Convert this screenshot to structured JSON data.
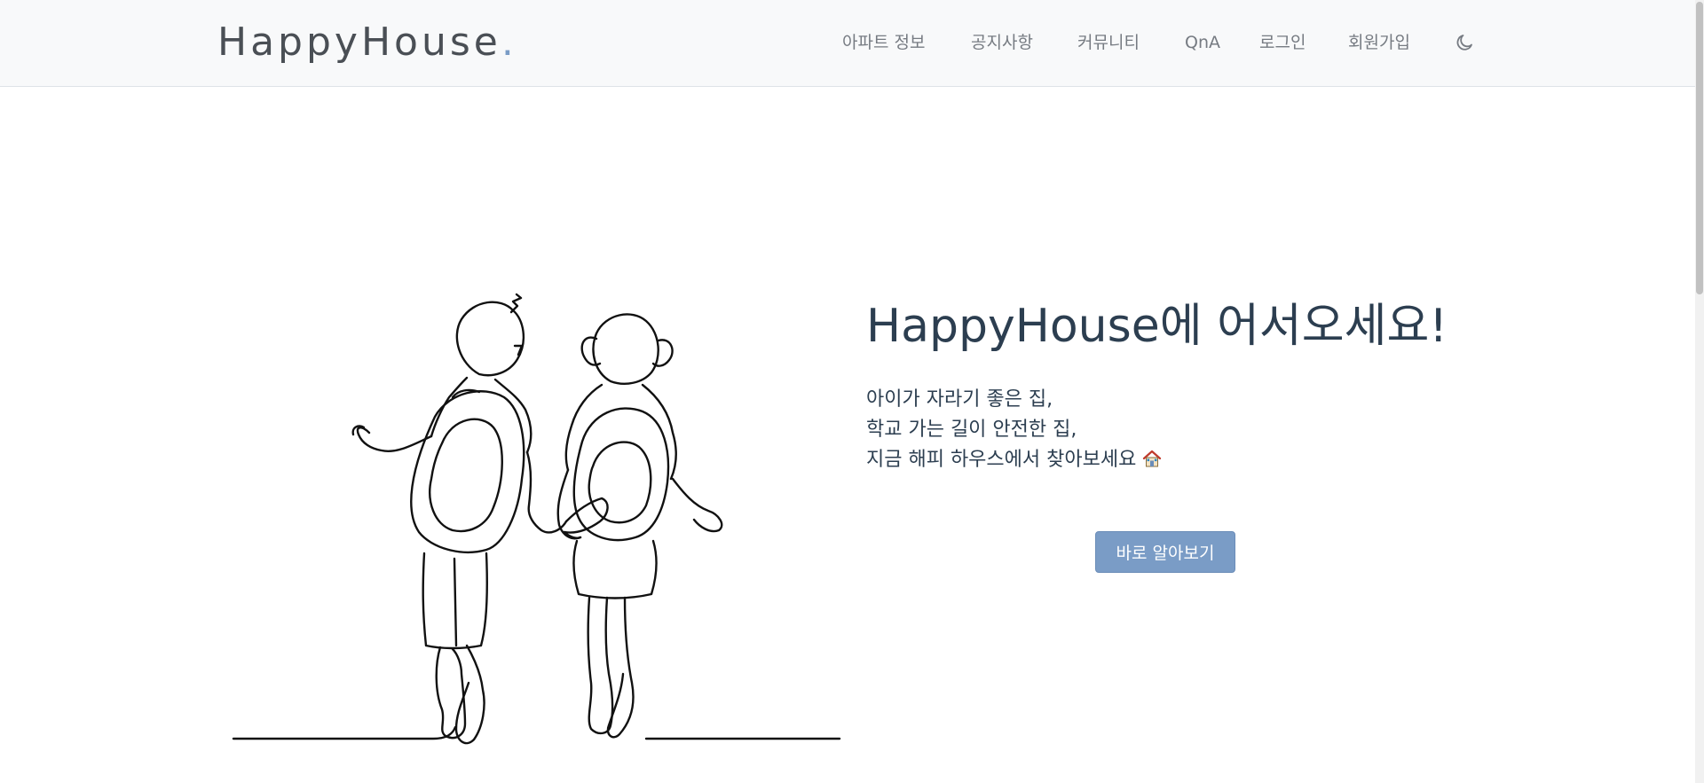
{
  "brand": {
    "name": "HappyHouse",
    "dot": "."
  },
  "nav": {
    "items": [
      {
        "label": "아파트 정보"
      },
      {
        "label": "공지사항"
      },
      {
        "label": "커뮤니티"
      },
      {
        "label": "QnA"
      },
      {
        "label": "로그인"
      },
      {
        "label": "회원가입"
      }
    ],
    "theme_toggle_icon": "moon-icon"
  },
  "hero": {
    "title": "HappyHouse에 어서오세요!",
    "lines": [
      "아이가 자라기 좋은 집,",
      "학교 가는 길이 안전한 집,",
      "지금 해피 하우스에서 찾아보세요"
    ],
    "line_icon": "house-icon",
    "illustration": "children-walking-line-art",
    "cta_label": "바로 알아보기"
  },
  "colors": {
    "accent": "#7a9cc6",
    "navbar_bg": "#f8f9fa",
    "title": "#2c3e50",
    "nav_text": "#767b82"
  }
}
